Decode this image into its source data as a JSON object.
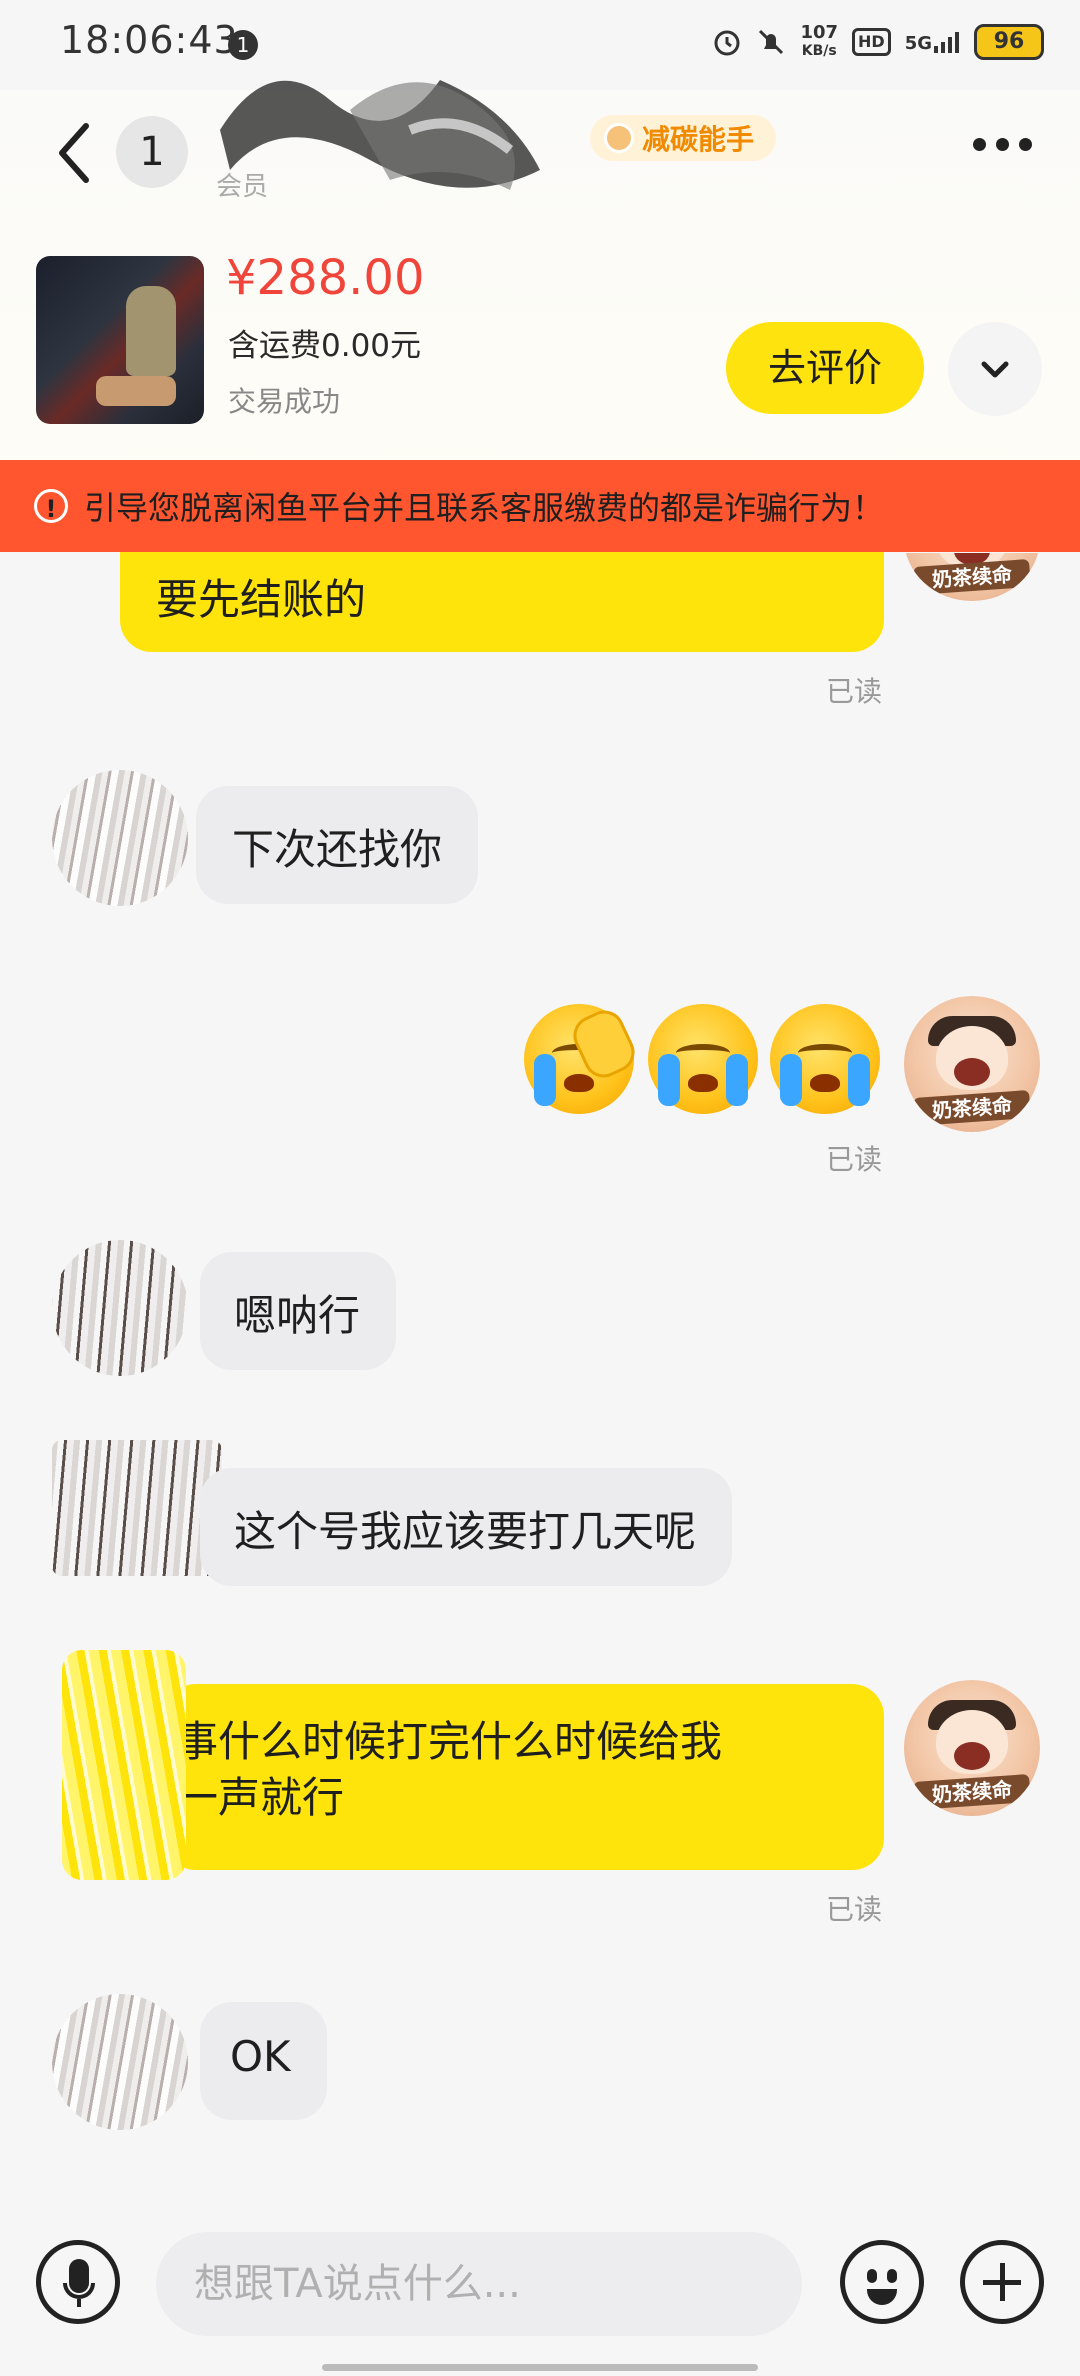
{
  "status_bar": {
    "time": "18:06:43",
    "notification_count": "1",
    "net_speed_value": "107",
    "net_speed_unit": "KB/s",
    "hd_label": "HD",
    "network": "5G",
    "battery": "96",
    "icons": [
      "alarm-icon",
      "mute-icon",
      "signal-icon"
    ]
  },
  "header": {
    "unread_count": "1",
    "user_subtitle": "会员",
    "carbon_badge": "减碳能手"
  },
  "product": {
    "price": "¥288.00",
    "shipping": "含运费0.00元",
    "deal_status": "交易成功",
    "review_button": "去评价"
  },
  "warning": {
    "text": "引导您脱离闲鱼平台并且联系客服缴费的都是诈骗行为！",
    "color": "#ff5630"
  },
  "messages": [
    {
      "from": "me",
      "text": "要先结账的",
      "read": "已读"
    },
    {
      "from": "them",
      "text": "下次还找你"
    },
    {
      "from": "me",
      "type": "emoji",
      "emojis": [
        "facepalm-cry-emoji",
        "crying-emoji",
        "crying-emoji"
      ],
      "read": "已读"
    },
    {
      "from": "them",
      "text": "嗯呐行"
    },
    {
      "from": "them",
      "text": "这个号我应该要打几天呢"
    },
    {
      "from": "me",
      "line1": "事什么时候打完什么时候给我",
      "line2": "一声就行",
      "read": "已读"
    },
    {
      "from": "them",
      "text": "OK"
    }
  ],
  "my_avatar_tag": "奶茶续命",
  "input": {
    "placeholder": "想跟TA说点什么..."
  },
  "colors": {
    "accent_yellow": "#ffe40b",
    "price_red": "#f0453a",
    "background": "#f6f6f7"
  }
}
